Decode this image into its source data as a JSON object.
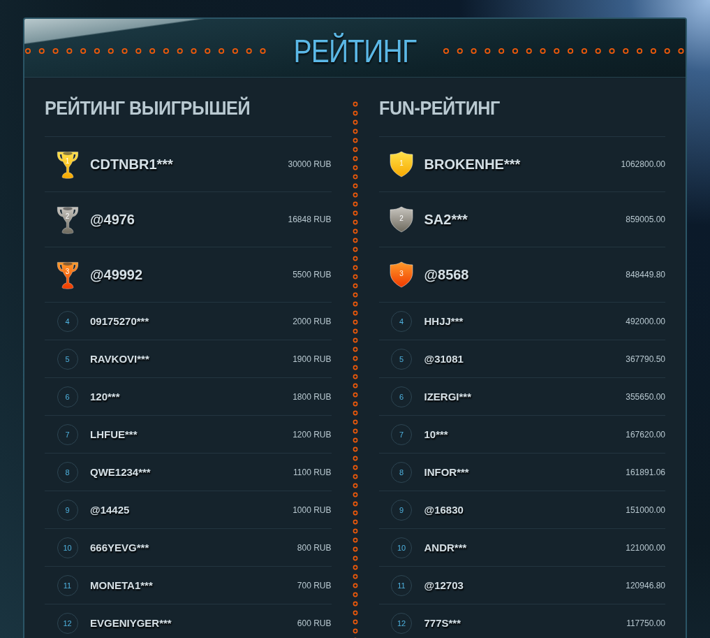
{
  "header": {
    "title": "РЕЙТИНГ"
  },
  "boards": [
    {
      "title": "РЕЙТИНГ ВЫИГРЫШЕЙ",
      "kind": "trophy",
      "entries": [
        {
          "rank": "1",
          "kind": "podium",
          "name": "CDTNBR1***",
          "amount": "30000 RUB"
        },
        {
          "rank": "2",
          "kind": "podium",
          "name": "@4976",
          "amount": "16848 RUB"
        },
        {
          "rank": "3",
          "kind": "podium",
          "name": "@49992",
          "amount": "5500 RUB"
        },
        {
          "rank": "4",
          "kind": "regular",
          "name": "09175270***",
          "amount": "2000 RUB"
        },
        {
          "rank": "5",
          "kind": "regular",
          "name": "RAVKOVI***",
          "amount": "1900 RUB"
        },
        {
          "rank": "6",
          "kind": "regular",
          "name": "120***",
          "amount": "1800 RUB"
        },
        {
          "rank": "7",
          "kind": "regular",
          "name": "LHFUE***",
          "amount": "1200 RUB"
        },
        {
          "rank": "8",
          "kind": "regular",
          "name": "QWE1234***",
          "amount": "1100 RUB"
        },
        {
          "rank": "9",
          "kind": "regular",
          "name": "@14425",
          "amount": "1000 RUB"
        },
        {
          "rank": "10",
          "kind": "regular",
          "name": "666YEVG***",
          "amount": "800 RUB"
        },
        {
          "rank": "11",
          "kind": "regular",
          "name": "MONETA1***",
          "amount": "700 RUB"
        },
        {
          "rank": "12",
          "kind": "regular",
          "name": "EVGENIYGER***",
          "amount": "600 RUB"
        }
      ]
    },
    {
      "title": "FUN-РЕЙТИНГ",
      "kind": "shield",
      "entries": [
        {
          "rank": "1",
          "kind": "podium",
          "name": "BROKENHE***",
          "amount": "1062800.00"
        },
        {
          "rank": "2",
          "kind": "podium",
          "name": "SA2***",
          "amount": "859005.00"
        },
        {
          "rank": "3",
          "kind": "podium",
          "name": "@8568",
          "amount": "848449.80"
        },
        {
          "rank": "4",
          "kind": "regular",
          "name": "HHJJ***",
          "amount": "492000.00"
        },
        {
          "rank": "5",
          "kind": "regular",
          "name": "@31081",
          "amount": "367790.50"
        },
        {
          "rank": "6",
          "kind": "regular",
          "name": "IZERGI***",
          "amount": "355650.00"
        },
        {
          "rank": "7",
          "kind": "regular",
          "name": "10***",
          "amount": "167620.00"
        },
        {
          "rank": "8",
          "kind": "regular",
          "name": "INFOR***",
          "amount": "161891.06"
        },
        {
          "rank": "9",
          "kind": "regular",
          "name": "@16830",
          "amount": "151000.00"
        },
        {
          "rank": "10",
          "kind": "regular",
          "name": "ANDR***",
          "amount": "121000.00"
        },
        {
          "rank": "11",
          "kind": "regular",
          "name": "@12703",
          "amount": "120946.80"
        },
        {
          "rank": "12",
          "kind": "regular",
          "name": "777S***",
          "amount": "117750.00"
        }
      ]
    }
  ]
}
